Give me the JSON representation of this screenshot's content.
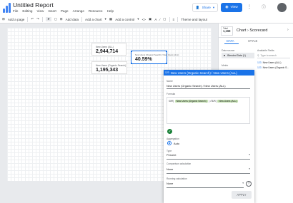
{
  "app": {
    "title": "Untitled Report"
  },
  "menu": [
    "File",
    "Editing",
    "View",
    "Insert",
    "Page",
    "Arrange",
    "Resource",
    "Help"
  ],
  "header": {
    "share_label": "Share",
    "view_label": "View"
  },
  "toolbar": {
    "add_page": "Add a page",
    "add_data": "Add data",
    "add_chart": "Add a chart",
    "add_control": "Add a control",
    "theme": "Theme and layout"
  },
  "canvas": {
    "cards": [
      {
        "label": "New Users (ALL)",
        "value": "2,944,714"
      },
      {
        "label": "New Users (Organic Search) / New Users (ALL)",
        "value": "40.59%"
      },
      {
        "label": "New Users (Organic Search)",
        "value": "1,195,343"
      }
    ]
  },
  "panel": {
    "scorecard_label": "Total",
    "scorecard_value": "1,168",
    "breadcrumb": "Chart",
    "breadcrumb_current": "Scorecard",
    "tab_data": "DATA",
    "tab_style": "STYLE",
    "data_source_label": "Data source",
    "data_source_value": "Blended Data (1)",
    "metric_label": "Metric",
    "available_fields_label": "Available Fields",
    "search_placeholder": "Type to search",
    "fields": [
      "New Users (ALL)",
      "New Users (Organic S..."
    ]
  },
  "dialog": {
    "title": "New Users (Organic Search) / New Users (ALL)",
    "name_label": "Name",
    "name_value": "New Users (Organic Search) / New Users (ALL)",
    "formula_label": "Formula",
    "formula_prefix": "SUM(",
    "formula_chip1": "New Users (Organic Search)",
    "formula_mid": ")/SUM(",
    "formula_chip2": "New Users (ALL)",
    "aggregation_label": "Aggregation",
    "aggregation_value": "Auto",
    "type_label": "Type",
    "type_value": "Percent",
    "comparison_label": "Comparison calculation",
    "comparison_value": "None",
    "running_label": "Running calculation",
    "running_value": "None",
    "apply_label": "APPLY"
  }
}
